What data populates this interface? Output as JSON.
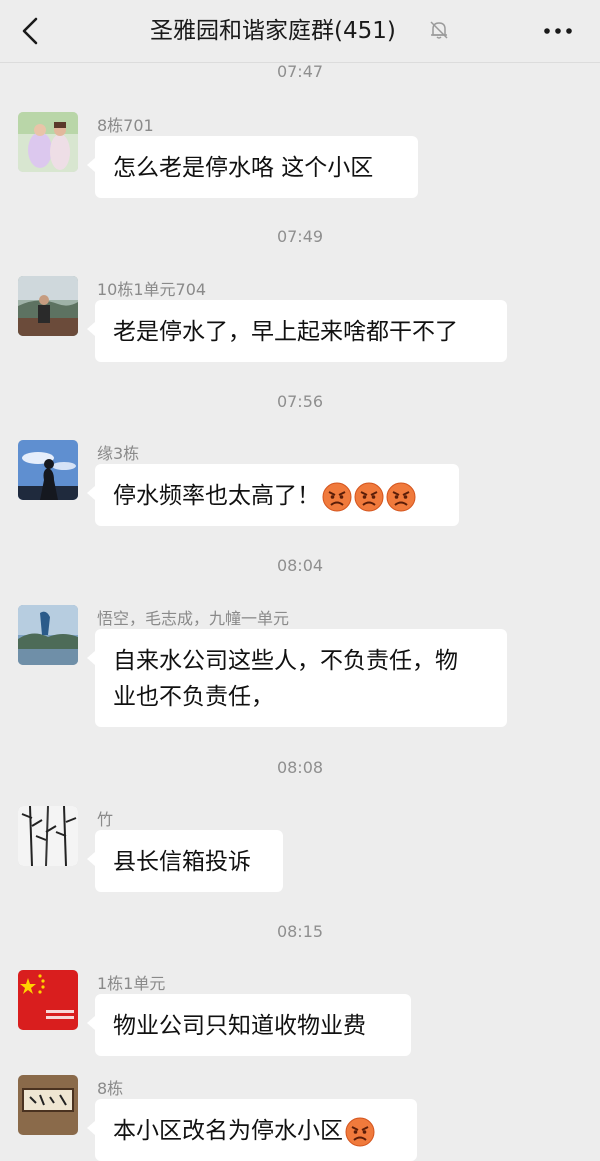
{
  "header": {
    "title": "圣雅园和谐家庭群(451)",
    "back_icon": "chevron-left-icon",
    "mute_icon": "bell-muted-icon",
    "more_icon": "more-dots-icon"
  },
  "chat": [
    {
      "time": "07:47",
      "sender": "8栋701",
      "text": "怎么老是停水咯 这个小区",
      "avatar": "couple-photo"
    },
    {
      "time": "07:49",
      "sender": "10栋1单元704",
      "text": "老是停水了，早上起来啥都干不了",
      "avatar": "person-outdoor"
    },
    {
      "time": "07:56",
      "sender": "缘3栋",
      "text": "停水频率也太高了！",
      "emoji_count": 3,
      "emoji": "angry-face-icon",
      "avatar": "silhouette-sky"
    },
    {
      "time": "08:04",
      "sender": "悟空，毛志成，九幢一单元",
      "text_line1": "自来水公司这些人，不负责任，物",
      "text_line2": "业也不负责任，",
      "avatar": "lake-landscape"
    },
    {
      "time": "08:08",
      "sender": "竹",
      "text": "县长信箱投诉",
      "avatar": "bamboo-ink"
    },
    {
      "time": "08:15",
      "sender": "1栋1单元",
      "text": "物业公司只知道收物业费",
      "avatar": "red-flag"
    },
    {
      "sender": "8栋",
      "text": "本小区改名为停水小区",
      "emoji": "angry-face-icon",
      "avatar": "calligraphy"
    }
  ],
  "colors": {
    "background": "#ededed",
    "bubble": "#ffffff",
    "meta_text": "#8a8a8a"
  }
}
